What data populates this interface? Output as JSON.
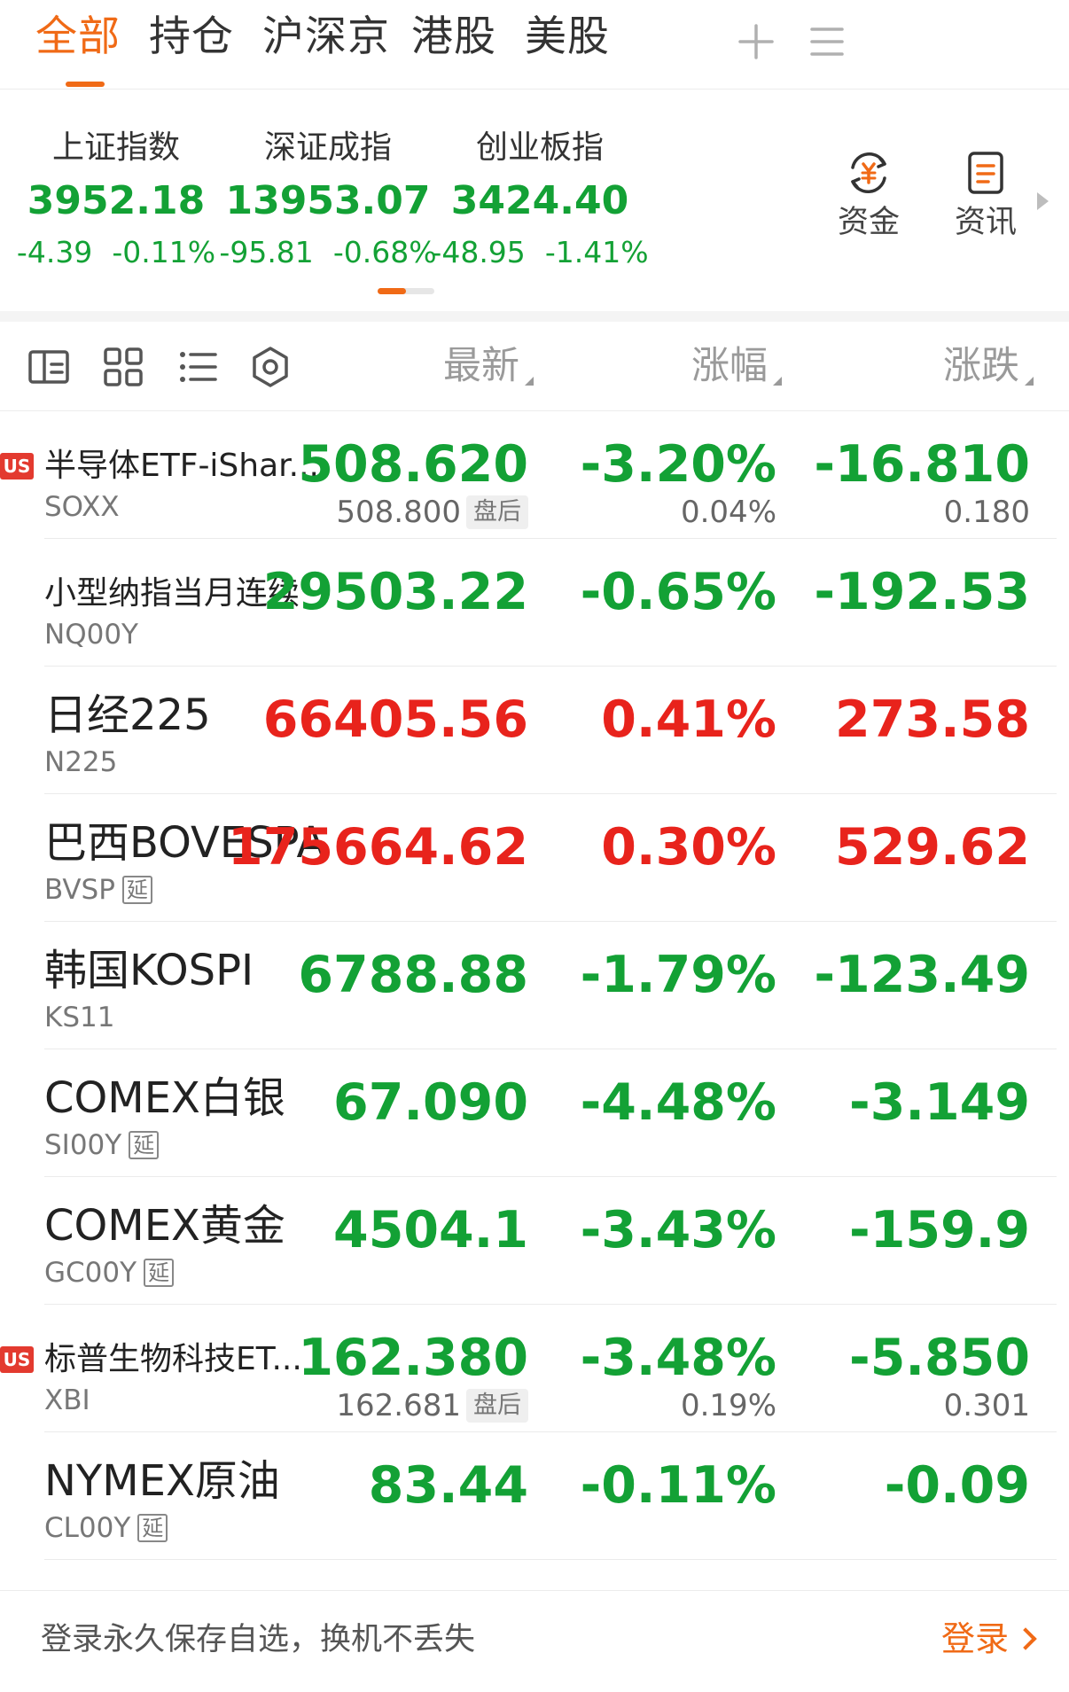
{
  "colors": {
    "accent": "#f06a16",
    "up": "#e8231c",
    "down": "#13a135",
    "us_badge": "#e33a2f"
  },
  "tabs": [
    {
      "label": "全部",
      "active": true
    },
    {
      "label": "持仓",
      "active": false
    },
    {
      "label": "沪深京",
      "active": false
    },
    {
      "label": "港股",
      "active": false
    },
    {
      "label": "美股",
      "active": false
    }
  ],
  "top_icons": [
    "plus-icon",
    "menu-icon"
  ],
  "indices": [
    {
      "name": "上证指数",
      "value": "3952.18",
      "change": "-4.39",
      "percent": "-0.11%"
    },
    {
      "name": "深证成指",
      "value": "13953.07",
      "change": "-95.81",
      "percent": "-0.68%"
    },
    {
      "name": "创业板指",
      "value": "3424.40",
      "change": "-48.95",
      "percent": "-1.41%"
    }
  ],
  "index_carousel_progress": 0.5,
  "quick_actions": [
    {
      "label": "资金",
      "icon": "yuan-exchange-icon"
    },
    {
      "label": "资讯",
      "icon": "news-icon"
    }
  ],
  "toolbar": {
    "icons": [
      "split-view-icon",
      "grid-view-icon",
      "list-view-icon",
      "settings-icon"
    ],
    "columns": {
      "price": "最新",
      "percent": "涨幅",
      "change": "涨跌"
    }
  },
  "rows": [
    {
      "name": "半导体ETF-iShar...",
      "code": "SOXX",
      "market": "US",
      "delayed": false,
      "big_name": false,
      "price": "508.620",
      "percent": "-3.20%",
      "change": "-16.810",
      "trend": "down",
      "after_hours": {
        "price": "508.800",
        "label": "盘后",
        "percent": "0.04%",
        "change": "0.180"
      }
    },
    {
      "name": "小型纳指当月连续",
      "code": "NQ00Y",
      "market": "",
      "delayed": false,
      "big_name": false,
      "price": "29503.22",
      "percent": "-0.65%",
      "change": "-192.53",
      "trend": "down"
    },
    {
      "name": "日经225",
      "code": "N225",
      "market": "",
      "delayed": false,
      "big_name": true,
      "price": "66405.56",
      "percent": "0.41%",
      "change": "273.58",
      "trend": "up"
    },
    {
      "name": "巴西BOVESPA",
      "code": "BVSP",
      "market": "",
      "delayed": true,
      "big_name": true,
      "price": "175664.62",
      "percent": "0.30%",
      "change": "529.62",
      "trend": "up"
    },
    {
      "name": "韩国KOSPI",
      "code": "KS11",
      "market": "",
      "delayed": false,
      "big_name": true,
      "price": "6788.88",
      "percent": "-1.79%",
      "change": "-123.49",
      "trend": "down"
    },
    {
      "name": "COMEX白银",
      "code": "SI00Y",
      "market": "",
      "delayed": true,
      "big_name": true,
      "price": "67.090",
      "percent": "-4.48%",
      "change": "-3.149",
      "trend": "down"
    },
    {
      "name": "COMEX黄金",
      "code": "GC00Y",
      "market": "",
      "delayed": true,
      "big_name": true,
      "price": "4504.1",
      "percent": "-3.43%",
      "change": "-159.9",
      "trend": "down"
    },
    {
      "name": "标普生物科技ET...",
      "code": "XBI",
      "market": "US",
      "delayed": false,
      "big_name": false,
      "price": "162.380",
      "percent": "-3.48%",
      "change": "-5.850",
      "trend": "down",
      "after_hours": {
        "price": "162.681",
        "label": "盘后",
        "percent": "0.19%",
        "change": "0.301"
      }
    },
    {
      "name": "NYMEX原油",
      "code": "CL00Y",
      "market": "",
      "delayed": true,
      "big_name": true,
      "price": "83.44",
      "percent": "-0.11%",
      "change": "-0.09",
      "trend": "down"
    }
  ],
  "delay_label": "延",
  "bottom_bar": {
    "text": "登录永久保存自选，换机不丢失",
    "action": "登录"
  }
}
